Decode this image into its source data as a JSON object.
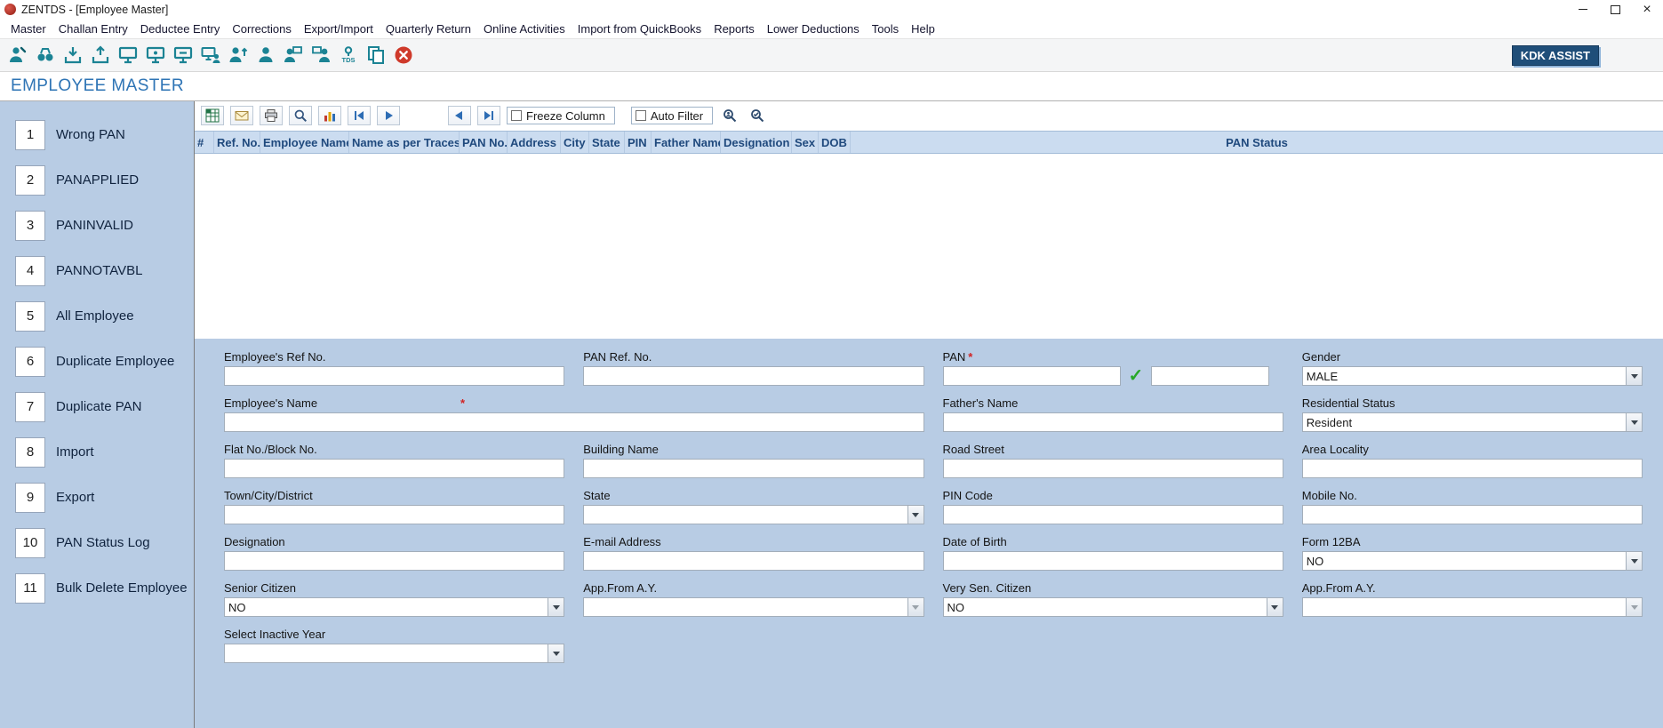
{
  "window": {
    "title": "ZENTDS - [Employee Master]"
  },
  "menu": {
    "items": [
      "Master",
      "Challan Entry",
      "Deductee Entry",
      "Corrections",
      "Export/Import",
      "Quarterly Return",
      "Online Activities",
      "Import from QuickBooks",
      "Reports",
      "Lower Deductions",
      "Tools",
      "Help"
    ]
  },
  "toolbar": {
    "kdk_assist_label": "KDK ASSIST"
  },
  "page": {
    "title": "EMPLOYEE MASTER"
  },
  "sidebar": {
    "items": [
      {
        "num": "1",
        "label": "Wrong PAN"
      },
      {
        "num": "2",
        "label": "PANAPPLIED"
      },
      {
        "num": "3",
        "label": "PANINVALID"
      },
      {
        "num": "4",
        "label": "PANNOTAVBL"
      },
      {
        "num": "5",
        "label": "All Employee"
      },
      {
        "num": "6",
        "label": "Duplicate Employee"
      },
      {
        "num": "7",
        "label": "Duplicate PAN"
      },
      {
        "num": "8",
        "label": "Import"
      },
      {
        "num": "9",
        "label": "Export"
      },
      {
        "num": "10",
        "label": "PAN Status Log"
      },
      {
        "num": "11",
        "label": "Bulk Delete Employee"
      }
    ]
  },
  "grid": {
    "toolbar": {
      "freeze_column_label": "Freeze Column",
      "auto_filter_label": "Auto Filter"
    },
    "columns": [
      "#",
      "Ref. No.",
      "Employee Name",
      "Name as per Traces",
      "PAN No.",
      "Address",
      "City",
      "State",
      "PIN",
      "Father Name",
      "Designation",
      "Sex",
      "DOB",
      "PAN Status"
    ],
    "rows": []
  },
  "form": {
    "required_marker": "*",
    "fields": {
      "employee_ref_no": {
        "label": "Employee's Ref No.",
        "value": ""
      },
      "pan_ref_no": {
        "label": "PAN Ref. No.",
        "value": ""
      },
      "pan": {
        "label": "PAN",
        "value": "",
        "value2": ""
      },
      "gender": {
        "label": "Gender",
        "value": "MALE"
      },
      "employee_name": {
        "label": "Employee's Name",
        "value": ""
      },
      "father_name": {
        "label": "Father's Name",
        "value": ""
      },
      "residential_status": {
        "label": "Residential Status",
        "value": "Resident"
      },
      "flat_no": {
        "label": "Flat No./Block No.",
        "value": ""
      },
      "building_name": {
        "label": "Building Name",
        "value": ""
      },
      "road_street": {
        "label": "Road Street",
        "value": ""
      },
      "area_locality": {
        "label": "Area Locality",
        "value": ""
      },
      "town": {
        "label": "Town/City/District",
        "value": ""
      },
      "state": {
        "label": "State",
        "value": ""
      },
      "pin_code": {
        "label": "PIN Code",
        "value": ""
      },
      "mobile_no": {
        "label": "Mobile No.",
        "value": ""
      },
      "designation": {
        "label": "Designation",
        "value": ""
      },
      "email": {
        "label": "E-mail Address",
        "value": ""
      },
      "dob": {
        "label": "Date of Birth",
        "value": ""
      },
      "form_12ba": {
        "label": "Form 12BA",
        "value": "NO"
      },
      "senior_citizen": {
        "label": "Senior Citizen",
        "value": "NO"
      },
      "app_from_ay1": {
        "label": "App.From A.Y.",
        "value": ""
      },
      "very_sen_citizen": {
        "label": "Very Sen. Citizen",
        "value": "NO"
      },
      "app_from_ay2": {
        "label": "App.From A.Y.",
        "value": ""
      },
      "select_inactive_year": {
        "label": "Select Inactive Year",
        "value": ""
      }
    }
  },
  "colors": {
    "accent_blue": "#2e74b5",
    "panel_blue": "#b8cce4",
    "grid_header_blue": "#cbdcf0",
    "kdk_navy": "#1f4e79",
    "icon_teal": "#1b8394",
    "close_red": "#cf3a2b",
    "check_green": "#27a827",
    "required_red": "#d22222"
  }
}
